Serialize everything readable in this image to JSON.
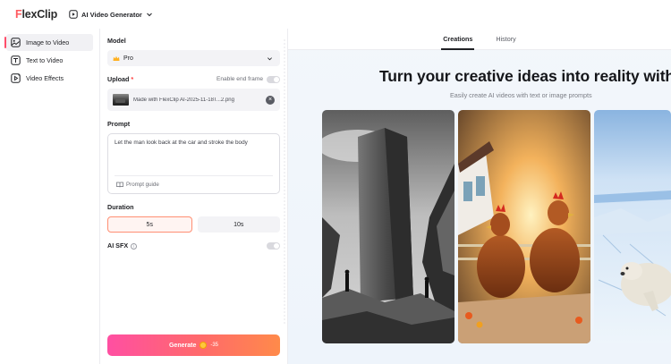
{
  "app": {
    "logo_first": "F",
    "logo_rest": "lexClip",
    "tool_name": "AI Video Generator"
  },
  "sidebar": {
    "items": [
      {
        "label": "Image to Video",
        "icon": "image-to-video-icon",
        "active": true
      },
      {
        "label": "Text to Video",
        "icon": "text-to-video-icon",
        "active": false
      },
      {
        "label": "Video Effects",
        "icon": "video-effects-icon",
        "active": false
      }
    ]
  },
  "panel": {
    "model_label": "Model",
    "model_value": "Pro",
    "upload_label": "Upload",
    "upload_required": "*",
    "end_frame_label": "Enable end frame",
    "file_name": "Made with FlexClip AI-2025-11-18T...2.png",
    "prompt_label": "Prompt",
    "prompt_text": "Let the man look back at the car and stroke the body",
    "prompt_guide": "Prompt guide",
    "duration_label": "Duration",
    "duration_options": [
      "5s",
      "10s"
    ],
    "duration_selected": "5s",
    "sfx_label": "AI SFX",
    "generate_label": "Generate",
    "generate_credits": "-35"
  },
  "main": {
    "tabs": [
      {
        "label": "Creations",
        "active": true
      },
      {
        "label": "History",
        "active": false
      }
    ],
    "hero_title": "Turn your creative ideas into reality with AI",
    "hero_subtitle": "Easily create AI videos with text or image prompts"
  },
  "colors": {
    "accent": "#ff4d6a",
    "generate_start": "#ff4fa2",
    "generate_end": "#ff8a4a"
  }
}
